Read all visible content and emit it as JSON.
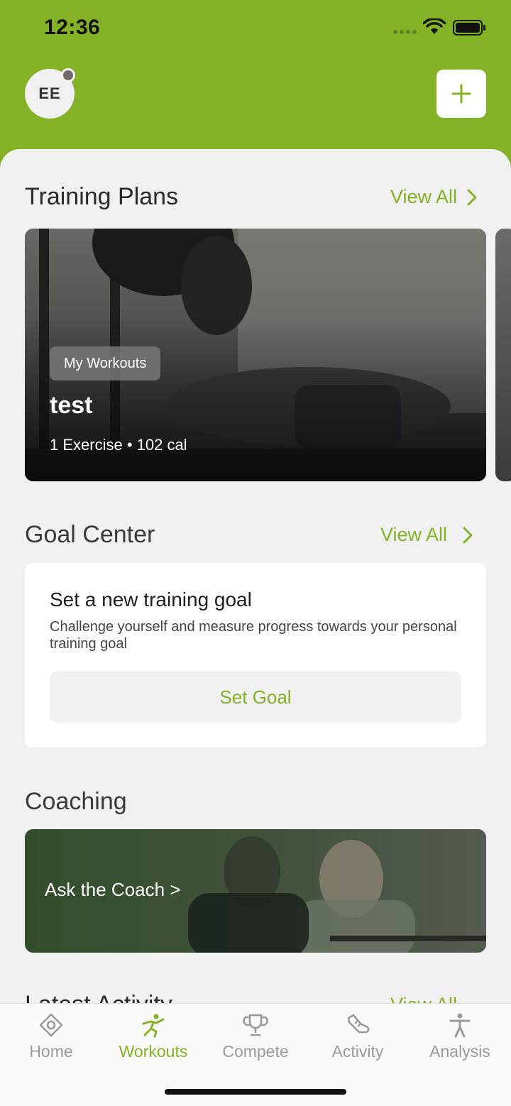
{
  "status": {
    "time": "12:36"
  },
  "header": {
    "avatar_initials": "EE"
  },
  "training": {
    "title": "Training Plans",
    "view_all": "View All",
    "card": {
      "tag": "My Workouts",
      "name": "test",
      "meta": "1 Exercise • 102 cal"
    }
  },
  "goal": {
    "title": "Goal Center",
    "view_all": "View All",
    "card_title": "Set a new training goal",
    "card_desc": "Challenge yourself and measure progress towards your personal training goal",
    "button": "Set Goal"
  },
  "coaching": {
    "title": "Coaching",
    "card_text": "Ask the Coach >"
  },
  "latest": {
    "title": "Latest Activity",
    "view_all": "View All"
  },
  "tabs": [
    {
      "label": "Home",
      "icon": "home-icon"
    },
    {
      "label": "Workouts",
      "icon": "workouts-icon",
      "active": true
    },
    {
      "label": "Compete",
      "icon": "trophy-icon"
    },
    {
      "label": "Activity",
      "icon": "activity-icon"
    },
    {
      "label": "Analysis",
      "icon": "analysis-icon"
    }
  ],
  "colors": {
    "accent": "#84b226",
    "background": "#f1f1f1",
    "inactive": "#9a9a9a"
  }
}
